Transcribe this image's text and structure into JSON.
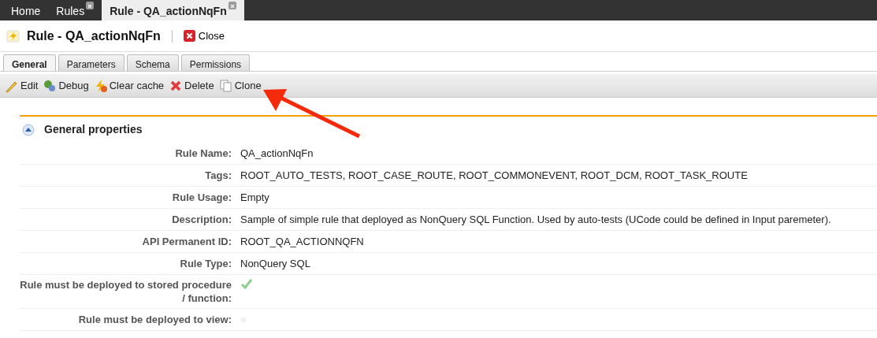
{
  "top_tabs": [
    {
      "label": "Home",
      "selected": false,
      "closable": false
    },
    {
      "label": "Rules",
      "selected": false,
      "closable": true
    },
    {
      "label": "Rule - QA_actionNqFn",
      "selected": true,
      "closable": true
    }
  ],
  "header": {
    "title": "Rule - QA_actionNqFn",
    "close_label": "Close"
  },
  "tabs": [
    {
      "label": "General",
      "selected": true
    },
    {
      "label": "Parameters",
      "selected": false
    },
    {
      "label": "Schema",
      "selected": false
    },
    {
      "label": "Permissions",
      "selected": false
    }
  ],
  "toolbar": [
    {
      "label": "Edit",
      "kind": "edit"
    },
    {
      "label": "Debug",
      "kind": "debug"
    },
    {
      "label": "Clear cache",
      "kind": "clear"
    },
    {
      "label": "Delete",
      "kind": "delete"
    },
    {
      "label": "Clone",
      "kind": "clone"
    }
  ],
  "section": {
    "title": "General properties",
    "expanded": true
  },
  "properties": [
    {
      "label": "Rule Name:",
      "kind": "text",
      "value": "QA_actionNqFn"
    },
    {
      "label": "Tags:",
      "kind": "text",
      "value": "ROOT_AUTO_TESTS, ROOT_CASE_ROUTE, ROOT_COMMONEVENT, ROOT_DCM, ROOT_TASK_ROUTE"
    },
    {
      "label": "Rule Usage:",
      "kind": "text",
      "value": "Empty"
    },
    {
      "label": "Description:",
      "kind": "text",
      "value": "Sample of simple rule that deployed as NonQuery SQL Function. Used by auto-tests (UCode could be defined in Input paremeter)."
    },
    {
      "label": "API Permanent ID:",
      "kind": "text",
      "value": "ROOT_QA_ACTIONNQFN"
    },
    {
      "label": "Rule Type:",
      "kind": "text",
      "value": "NonQuery SQL"
    },
    {
      "label": "Rule must be deployed to stored procedure / function:",
      "kind": "flag",
      "checked": true
    },
    {
      "label": "Rule must be deployed to view:",
      "kind": "flag",
      "checked": false
    }
  ]
}
